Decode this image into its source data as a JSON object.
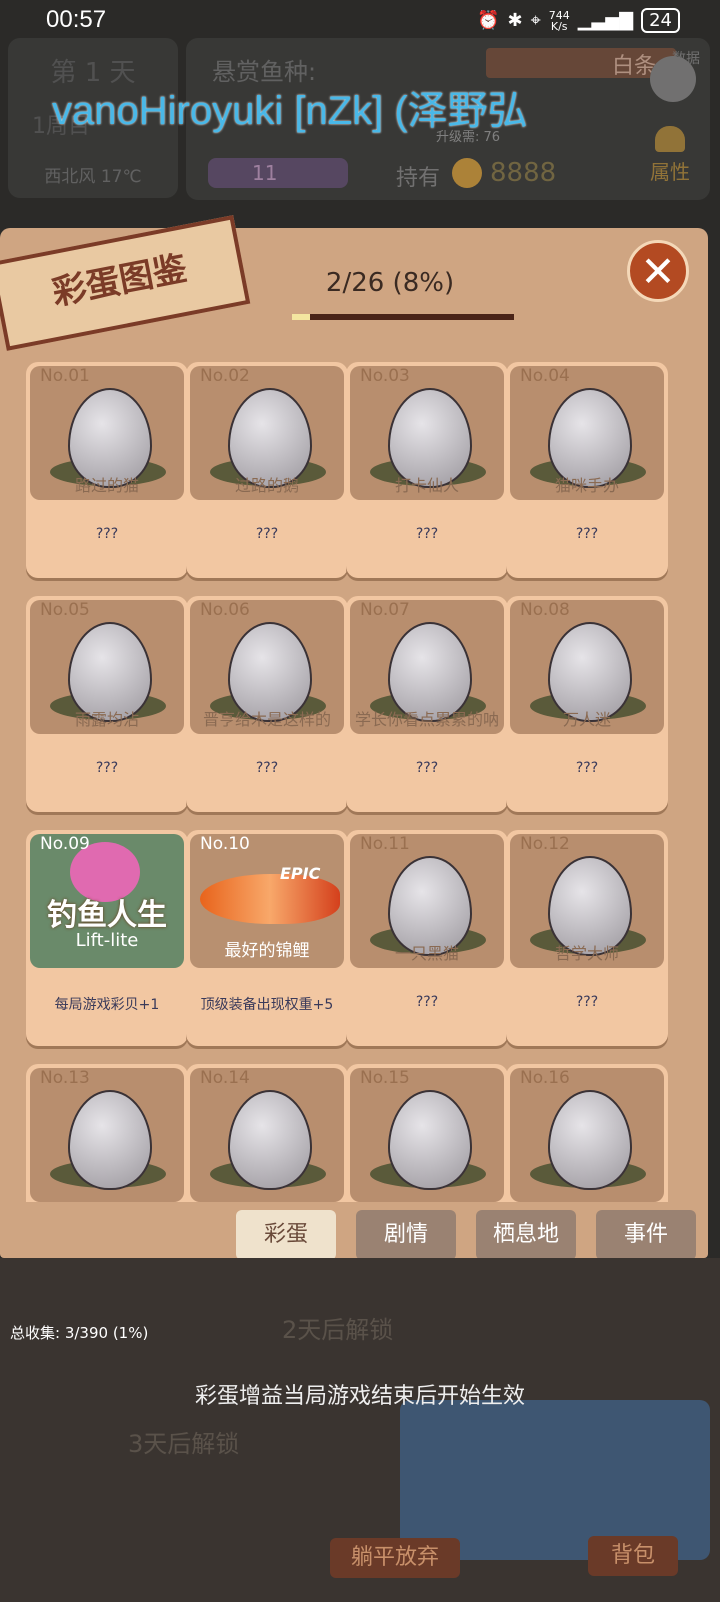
{
  "status": {
    "time": "00:57",
    "net_speed": "744",
    "net_unit": "K/s",
    "battery": "24"
  },
  "watermark": "vanoHiroyuki [nZk] (泽野弘",
  "hud": {
    "day": "第 1 天",
    "week": "1周目",
    "weather": "西北风 17℃",
    "reward_label": "悬赏鱼种:",
    "reward_fish": "白条",
    "upgrade": "升级需: 76",
    "shells": "11",
    "hold_label": "持有",
    "coins": "8888",
    "attr_label": "属性",
    "data_btn": "数据",
    "notice": "公告"
  },
  "modal": {
    "title": "彩蛋图鉴",
    "progress_text": "2/26 (8%)",
    "progress_fraction": 0.08,
    "close_icon": "close-x-icon"
  },
  "cards": [
    {
      "no": "No.01",
      "name": "路过的猫",
      "desc": "???"
    },
    {
      "no": "No.02",
      "name": "过路的鹅",
      "desc": "???"
    },
    {
      "no": "No.03",
      "name": "打卡仙人",
      "desc": "???"
    },
    {
      "no": "No.04",
      "name": "猫咪手办",
      "desc": "???"
    },
    {
      "no": "No.05",
      "name": "雨露均沾",
      "desc": "???"
    },
    {
      "no": "No.06",
      "name": "晋亨给木是这样的",
      "desc": "???"
    },
    {
      "no": "No.07",
      "name": "学长你看点累累的呐",
      "desc": "???"
    },
    {
      "no": "No.08",
      "name": "万人迷",
      "desc": "???"
    },
    {
      "no": "No.09",
      "art_title": "钓鱼人生",
      "art_sub": "Lift-lite",
      "desc": "每局游戏彩贝+1"
    },
    {
      "no": "No.10",
      "art_name": "最好的锦鲤",
      "art_badge": "EPIC",
      "desc": "顶级装备出现权重+5"
    },
    {
      "no": "No.11",
      "name": "一只黑猫",
      "desc": "???"
    },
    {
      "no": "No.12",
      "name": "哲学大师",
      "desc": "???"
    },
    {
      "no": "No.13",
      "name": "",
      "desc": ""
    },
    {
      "no": "No.14",
      "name": "",
      "desc": ""
    },
    {
      "no": "No.15",
      "name": "",
      "desc": ""
    },
    {
      "no": "No.16",
      "name": "",
      "desc": ""
    }
  ],
  "tabs": [
    "彩蛋",
    "剧情",
    "栖息地",
    "事件"
  ],
  "footer": {
    "total": "总收集: 3/390 (1%)",
    "unlock2": "2天后解锁",
    "hint": "彩蛋增益当局游戏结束后开始生效",
    "unlock3": "3天后解锁",
    "give_up": "躺平放弃",
    "bag": "背包"
  }
}
